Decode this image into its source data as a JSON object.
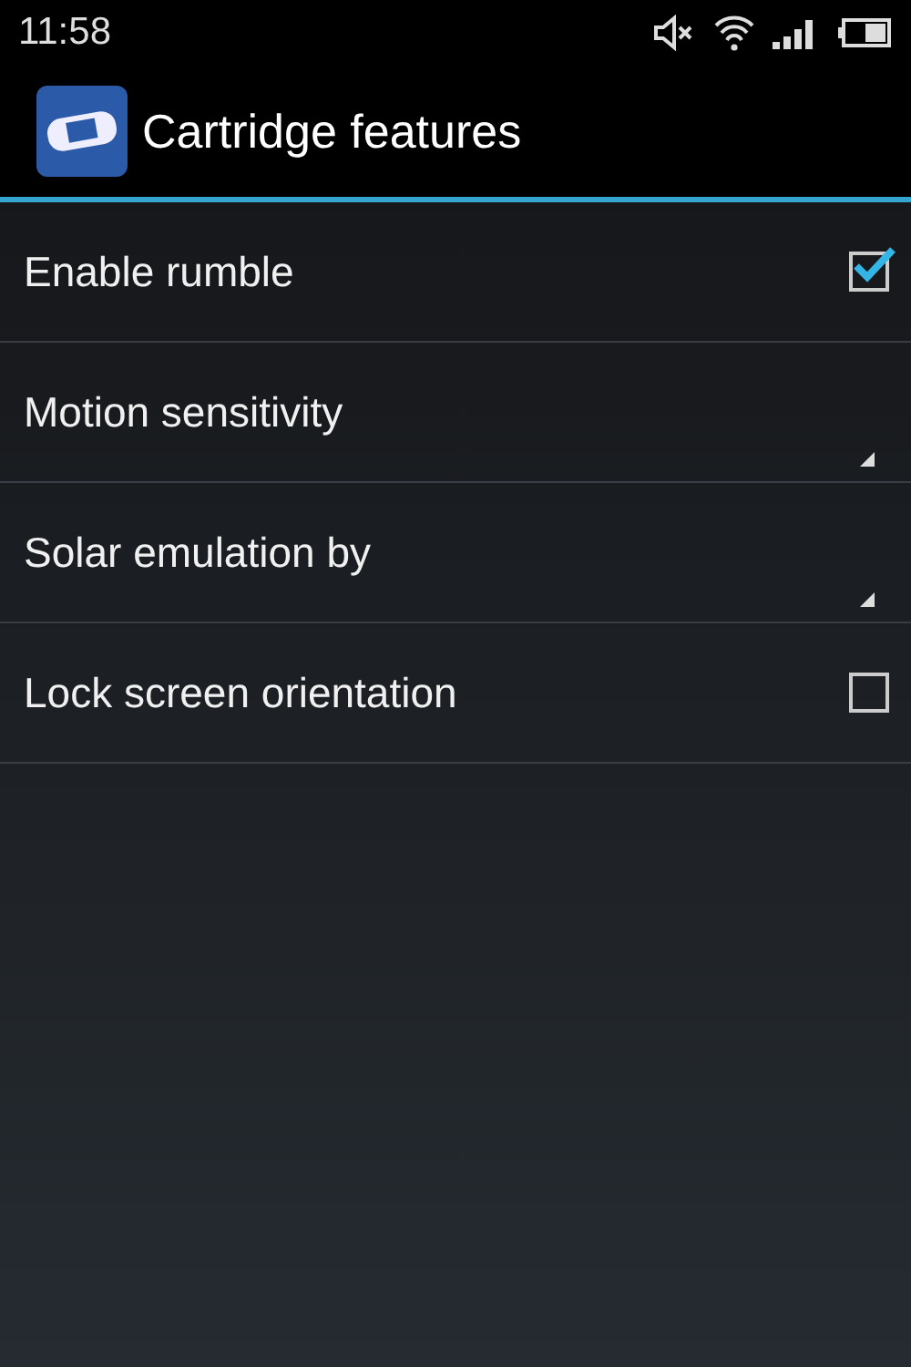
{
  "status_bar": {
    "time": "11:58"
  },
  "action_bar": {
    "title": "Cartridge features"
  },
  "preferences": [
    {
      "kind": "checkbox",
      "label": "Enable rumble",
      "checked": true
    },
    {
      "kind": "list",
      "label": "Motion sensitivity"
    },
    {
      "kind": "list",
      "label": "Solar emulation by"
    },
    {
      "kind": "checkbox",
      "label": "Lock screen orientation",
      "checked": false
    }
  ]
}
